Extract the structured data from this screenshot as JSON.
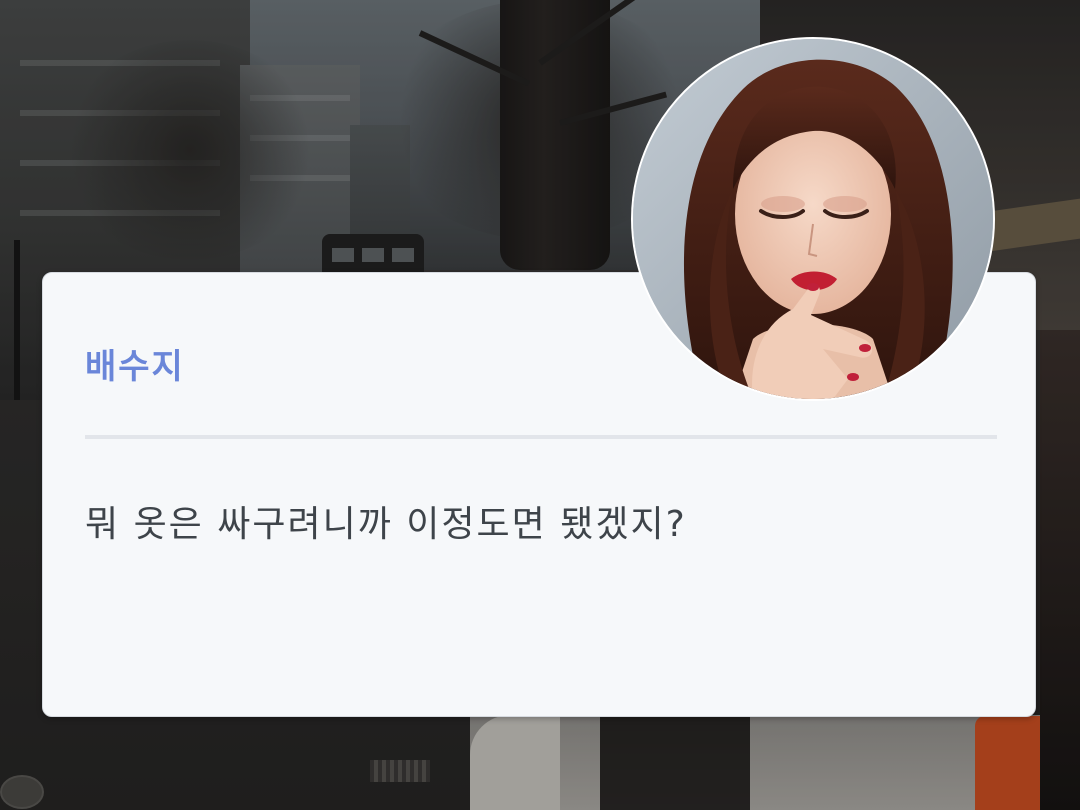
{
  "dialog": {
    "speaker_name": "배수지",
    "message": "뭐 옷은 싸구려니까 이정도면 됐겠지?"
  },
  "colors": {
    "speaker_name": "#6a86d9",
    "message_text": "#3e444a",
    "card_background": "#f6f8fa",
    "divider": "#e2e5ea"
  },
  "avatar": {
    "icon": "character-portrait"
  }
}
